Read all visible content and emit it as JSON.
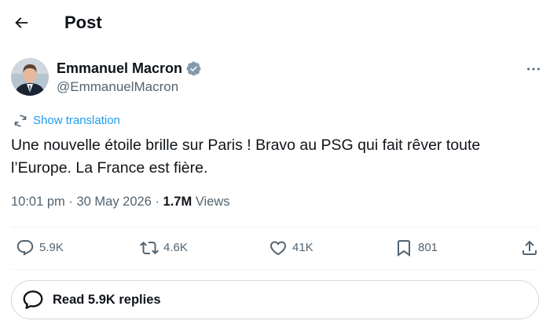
{
  "header": {
    "title": "Post"
  },
  "author": {
    "name": "Emmanuel Macron",
    "handle": "@EmmanuelMacron"
  },
  "post": {
    "translation_link": "Show translation",
    "text": "Une nouvelle étoile brille sur Paris ! Bravo au PSG qui fait rêver toute l’Europe. La France est fière.",
    "time": "10:01 pm",
    "date": "30 May 2026",
    "views_count": "1.7M",
    "views_label": "Views"
  },
  "actions": {
    "replies": "5.9K",
    "reposts": "4.6K",
    "likes": "41K",
    "bookmarks": "801"
  },
  "replies_button": {
    "label": "Read 5.9K replies"
  },
  "colors": {
    "text": "#0f1419",
    "secondary": "#536471",
    "accent": "#1d9bf0",
    "border": "#cfd9de"
  },
  "icons": [
    "back-arrow-icon",
    "verified-badge-icon",
    "more-icon",
    "translate-icon",
    "reply-icon",
    "repost-icon",
    "like-icon",
    "bookmark-icon",
    "share-icon",
    "speech-bubble-icon"
  ]
}
